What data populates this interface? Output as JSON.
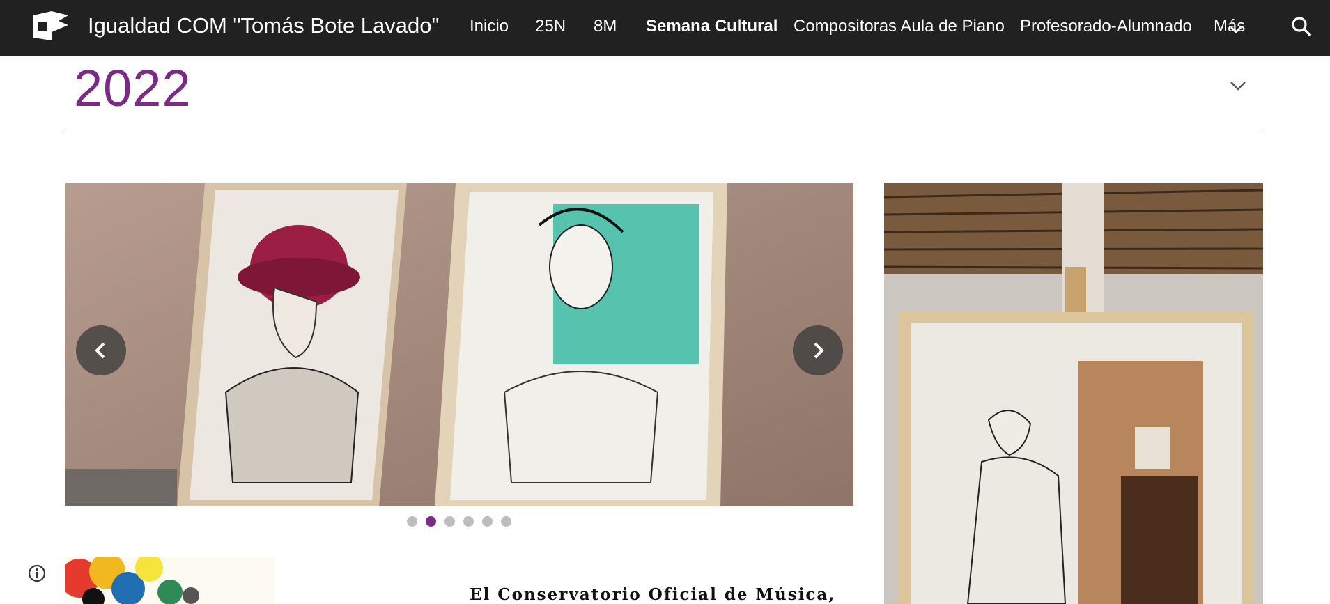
{
  "site": {
    "title": "Igualdad COM \"Tomás Bote Lavado\"",
    "logo_icon": "site-logo-icon"
  },
  "nav": {
    "items": [
      {
        "label": "Inicio",
        "active": false
      },
      {
        "label": "25N",
        "active": false
      },
      {
        "label": "8M",
        "active": false
      },
      {
        "label": "Semana Cultural",
        "active": true
      },
      {
        "label": "Compositoras Aula de Piano",
        "active": false
      },
      {
        "label": "Profesorado-Alumnado",
        "active": false
      },
      {
        "label": "Más",
        "active": false
      }
    ],
    "more_icon": "chevron-down-icon",
    "search_icon": "search-icon"
  },
  "section": {
    "year": "2022",
    "collapse_icon": "chevron-down-icon"
  },
  "carousel": {
    "slide_count": 6,
    "active_index": 1,
    "prev_icon": "chevron-left-icon",
    "next_icon": "chevron-right-icon"
  },
  "content": {
    "poster_text": "El Conservatorio Oficial de Música,"
  },
  "footer": {
    "info_icon": "info-icon"
  },
  "colors": {
    "nav_bg": "#212121",
    "accent": "#7b2b85",
    "dot_inactive": "#bdbdbd"
  }
}
